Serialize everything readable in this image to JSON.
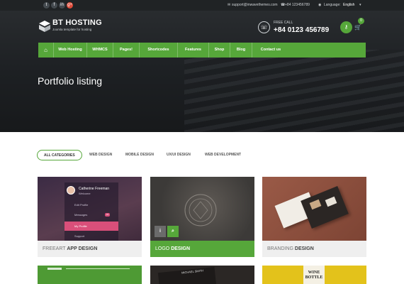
{
  "topbar": {
    "social_icons": [
      "twitter-icon",
      "facebook-icon",
      "linkedin-icon",
      "google-plus-icon"
    ],
    "social_glyphs": [
      "t",
      "f",
      "in",
      "g+"
    ],
    "email": "support@inwavethemes.com",
    "phone": "+84 123456789",
    "language_label": "Language:",
    "language_value": "English"
  },
  "header": {
    "brand": "BT HOSTING",
    "tagline": "Joomla template for hosting",
    "free_call_label": "FREE CALL",
    "phone_number": "+84 0123 456789",
    "cart_count": "0"
  },
  "nav": {
    "items": [
      "Web Hosting",
      "WHMCS",
      "Pages!",
      "Shortcodes",
      "Features",
      "Shop",
      "Blog",
      "Contact us"
    ]
  },
  "hero": {
    "title": "Portfolio listing"
  },
  "filters": [
    "ALL CATEGORIES",
    "WEB DESIGN",
    "MOBILE DESIGN",
    "UX/UI DESIGN",
    "WEB DEVELOPMENT"
  ],
  "cards": [
    {
      "light": "FREEART",
      "bold": "APP DESIGN"
    },
    {
      "light": "LOGO",
      "bold": "DESIGN"
    },
    {
      "light": "BRANDING",
      "bold": "DESIGN"
    }
  ],
  "app_mock": {
    "name": "Catherine Freeman",
    "sub": "Welcome",
    "menu": [
      "Edit Profile",
      "Messages",
      "My Profile",
      "Support"
    ],
    "badge": "24"
  },
  "bottom_cards": {
    "wine_line1": "WINE",
    "wine_line2": "BOTTLE",
    "card_name": "MICHAEL SMITH"
  },
  "colors": {
    "accent": "#56a73a",
    "dark": "#1d2023",
    "caption_bg": "#efefef"
  }
}
